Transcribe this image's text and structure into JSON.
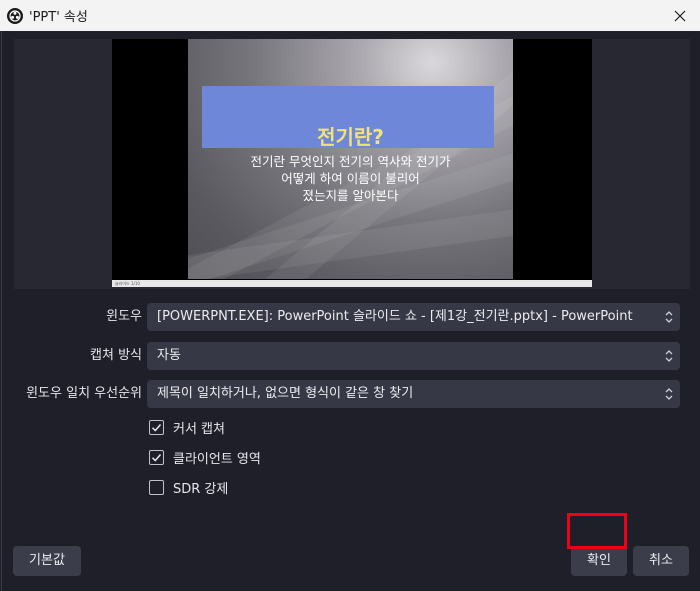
{
  "window": {
    "title": "'PPT' 속성"
  },
  "preview": {
    "slide_title": "전기란?",
    "slide_body_lines": [
      "전기란 무엇인지 전기의 역사와 전기가",
      "어떻게 하여 이름이 불리어",
      "졌는지를 알아본다"
    ],
    "status_text": "슬라이드 1/10"
  },
  "form": {
    "window_label": "윈도우",
    "window_value": "[POWERPNT.EXE]: PowerPoint 슬라이드 쇼 - [제1강_전기란.pptx] - PowerPoint",
    "capture_method_label": "캡쳐 방식",
    "capture_method_value": "자동",
    "window_match_label": "윈도우 일치 우선순위",
    "window_match_value": "제목이 일치하거나, 없으면 형식이 같은 창 찾기"
  },
  "checkboxes": [
    {
      "label": "커서 캡쳐",
      "checked": true
    },
    {
      "label": "클라이언트 영역",
      "checked": true
    },
    {
      "label": "SDR 강제",
      "checked": false
    }
  ],
  "buttons": {
    "defaults": "기본값",
    "ok": "확인",
    "cancel": "취소"
  },
  "colors": {
    "highlight": "#f00017",
    "slide_header": "#6f87d8",
    "slide_title": "#f2e27a"
  }
}
